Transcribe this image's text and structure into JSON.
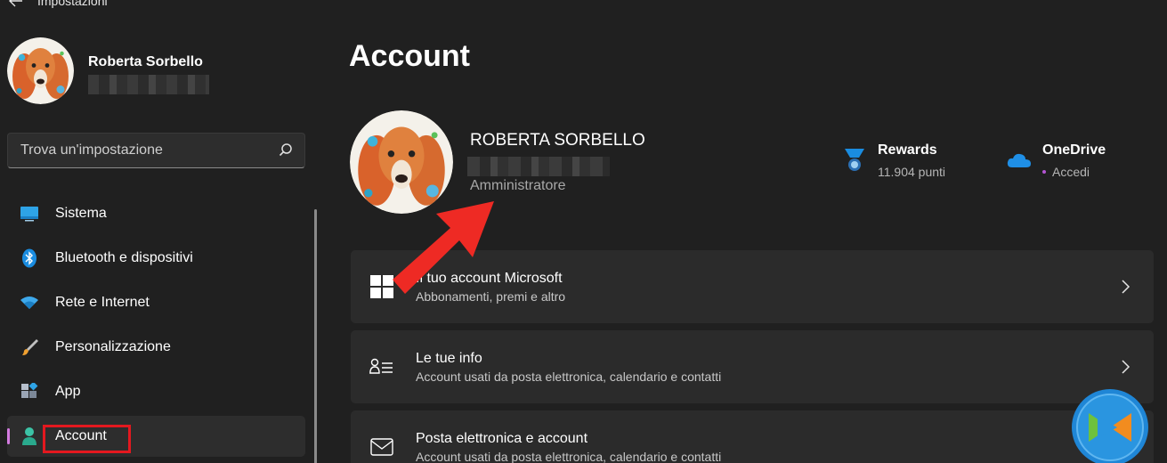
{
  "window": {
    "title": "Impostazioni"
  },
  "user": {
    "name": "Roberta Sorbello",
    "name_upper": "ROBERTA SORBELLO",
    "role": "Amministratore"
  },
  "search": {
    "placeholder": "Trova un'impostazione"
  },
  "sidebar": {
    "items": [
      {
        "label": "Sistema",
        "icon": "monitor-icon"
      },
      {
        "label": "Bluetooth e dispositivi",
        "icon": "bluetooth-icon"
      },
      {
        "label": "Rete e Internet",
        "icon": "wifi-icon"
      },
      {
        "label": "Personalizzazione",
        "icon": "brush-icon"
      },
      {
        "label": "App",
        "icon": "apps-icon"
      },
      {
        "label": "Account",
        "icon": "person-icon",
        "active": true
      }
    ]
  },
  "main": {
    "title": "Account",
    "rewards": {
      "title": "Rewards",
      "value": "11.904 punti"
    },
    "onedrive": {
      "title": "OneDrive",
      "status": "Accedi"
    },
    "cards": [
      {
        "title": "Il tuo account Microsoft",
        "subtitle": "Abbonamenti, premi e altro",
        "icon": "windows-logo-icon"
      },
      {
        "title": "Le tue info",
        "subtitle": "Account usati da posta elettronica, calendario e contatti",
        "icon": "user-info-icon"
      },
      {
        "title": "Posta elettronica e account",
        "subtitle": "Account usati da posta elettronica, calendario e contatti",
        "icon": "mail-icon"
      }
    ]
  },
  "colors": {
    "background": "#202020",
    "card": "#2b2b2b",
    "accent_pink": "#d47be0",
    "highlight_red": "#e3181f",
    "arrow_red": "#ee2a24"
  }
}
